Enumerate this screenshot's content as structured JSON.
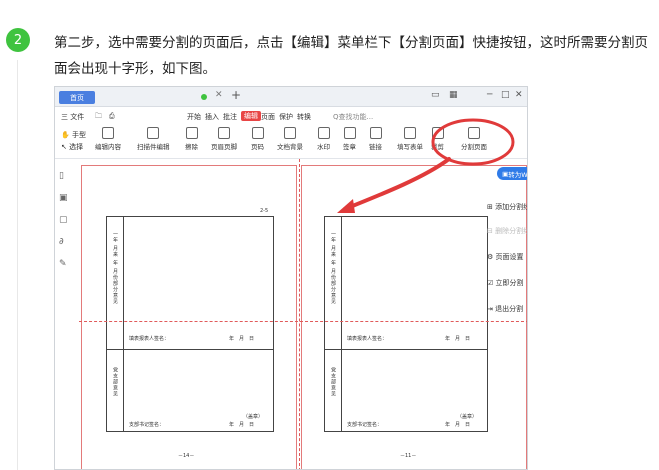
{
  "step": {
    "number": "2"
  },
  "instruction": "第二步，选中需要分割的页面后，点击【编辑】菜单栏下【分割页面】快捷按钮，这时所需要分割页面会出现十字形，如下图。",
  "screenshot": {
    "tab_label": "首页",
    "menu": {
      "file": "三 文件",
      "items": [
        "开始",
        "插入",
        "批注",
        "编辑",
        "页面",
        "保护",
        "转换"
      ],
      "active": "编辑",
      "search": "Q查找功能..."
    },
    "hand_tool": "手型",
    "select_tool": "选择",
    "tools": [
      "编辑内容",
      "扫描件编辑",
      "擦除",
      "页眉页脚",
      "页码",
      "文档背景",
      "水印",
      "签章",
      "链接",
      "填写表单",
      "裁剪",
      "分割页面"
    ],
    "to_word": "转为Word",
    "side_panel": [
      "添加分割线",
      "删除分割线",
      "页面设置",
      "立即分割",
      "退出分割"
    ],
    "page_labels": {
      "left_top": "2-5",
      "left_bottom": "－14－",
      "right_bottom": "－11－"
    },
    "form_text": {
      "lines": [
        "年",
        "月",
        "日",
        "年",
        "月",
        "份",
        "的",
        "部",
        "分",
        "意",
        "见"
      ],
      "col1": "一年 月来 年 月份部分意见",
      "col2": "党支部意见",
      "sig1": "填表报表人签名：",
      "sig1_date": "年　月　日",
      "sig2": "支部书记签名：",
      "sig2_seal": "（盖章）",
      "sig2_date": "年　月　日"
    },
    "colors": {
      "accent": "#4a7fe0",
      "active_menu": "#e84545",
      "highlight": "#e03a3a",
      "step_badge": "#3fc33f"
    }
  }
}
